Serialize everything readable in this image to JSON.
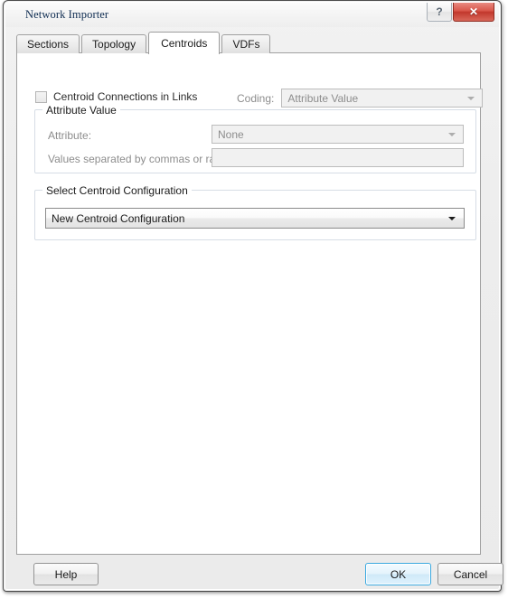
{
  "window": {
    "title": "Network Importer",
    "help_button_glyph": "?",
    "close_button_glyph": "✕"
  },
  "tabs": [
    {
      "label": "Sections",
      "active": false
    },
    {
      "label": "Topology",
      "active": false
    },
    {
      "label": "Centroids",
      "active": true
    },
    {
      "label": "VDFs",
      "active": false
    }
  ],
  "centroids": {
    "centroid_connections_checkbox": {
      "label": "Centroid Connections in Links",
      "checked": false
    },
    "coding": {
      "label": "Coding:",
      "value": "Attribute Value",
      "enabled": false
    },
    "attribute_value_group": {
      "title": "Attribute Value",
      "attribute": {
        "label": "Attribute:",
        "value": "None",
        "enabled": false
      },
      "values_range": {
        "label": "Values separated by commas or range:",
        "value": "",
        "enabled": false
      }
    },
    "select_centroid_configuration_group": {
      "title": "Select Centroid Configuration",
      "configuration": {
        "value": "New Centroid Configuration",
        "enabled": true
      }
    }
  },
  "footer": {
    "help_label": "Help",
    "ok_label": "OK",
    "cancel_label": "Cancel"
  },
  "colors": {
    "close_button": "#c2372c",
    "default_button_border": "#3aa9e0",
    "disabled_text": "#8d8d8d"
  }
}
